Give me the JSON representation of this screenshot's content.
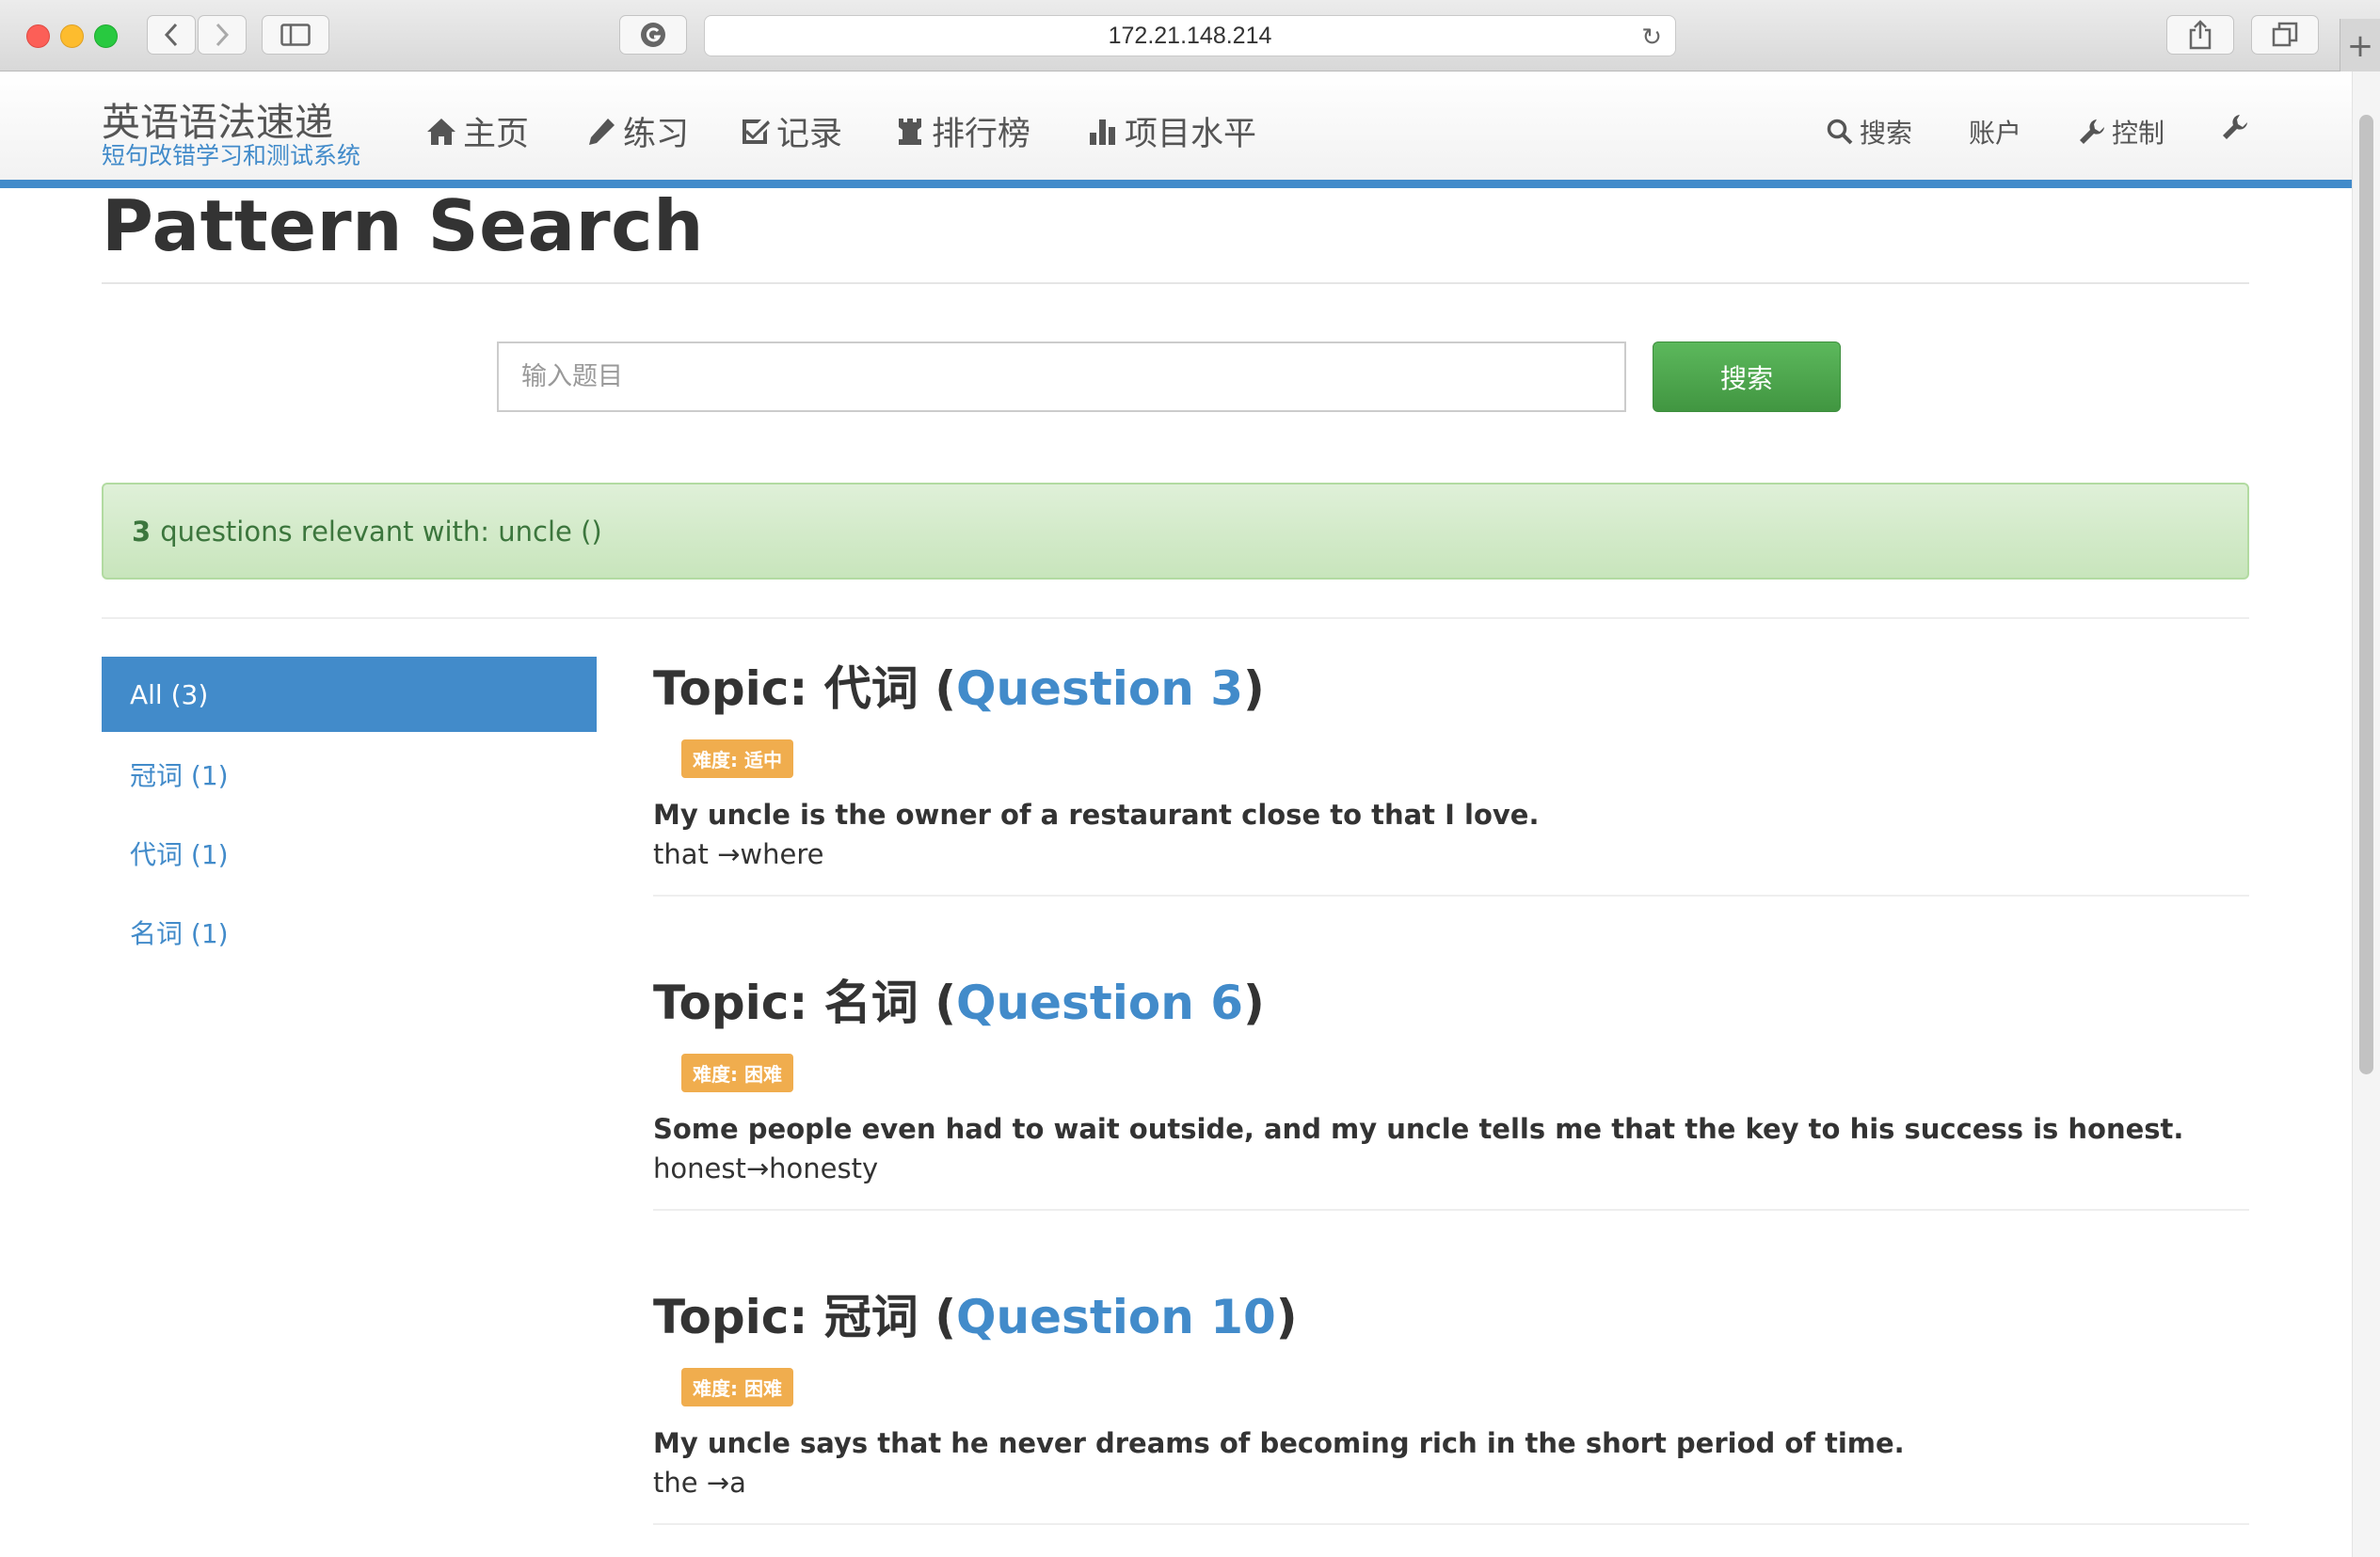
{
  "browser": {
    "url": "172.21.148.214"
  },
  "navbar": {
    "brand_title": "英语语法速递",
    "brand_subtitle": "短句改错学习和测试系统",
    "items": [
      {
        "label": "主页",
        "icon": "home-icon"
      },
      {
        "label": "练习",
        "icon": "pencil-icon"
      },
      {
        "label": "记录",
        "icon": "check-square-icon"
      },
      {
        "label": "排行榜",
        "icon": "tower-icon"
      },
      {
        "label": "项目水平",
        "icon": "bar-chart-icon"
      }
    ],
    "right_items": [
      {
        "label": "搜索",
        "icon": "search-icon"
      },
      {
        "label": "账户",
        "icon": ""
      },
      {
        "label": "控制",
        "icon": "wrench-icon"
      },
      {
        "label": "",
        "icon": "wrench-icon"
      }
    ]
  },
  "page": {
    "title": "Pattern Search"
  },
  "search": {
    "placeholder": "输入题目",
    "value": "",
    "button_label": "搜索"
  },
  "alert": {
    "count": "3",
    "text": "questions relevant with: uncle ()"
  },
  "sidebar": {
    "active": "All (3)",
    "items": [
      "冠词 (1)",
      "代词 (1)",
      "名词 (1)"
    ]
  },
  "results": [
    {
      "topic_prefix": "Topic: 代词 (",
      "question_link": "Question 3",
      "topic_suffix": ")",
      "difficulty": "难度: 适中",
      "sentence": "My uncle is the owner of a restaurant close to that I love.",
      "correction": "that →where"
    },
    {
      "topic_prefix": "Topic: 名词 (",
      "question_link": "Question 6",
      "topic_suffix": ")",
      "difficulty": "难度: 困难",
      "sentence": "Some people even had to wait outside, and my uncle tells me that the key to his success is honest.",
      "correction": "honest→honesty"
    },
    {
      "topic_prefix": "Topic: 冠词 (",
      "question_link": "Question 10",
      "topic_suffix": ")",
      "difficulty": "难度: 困难",
      "sentence": "My uncle says that he never dreams of becoming rich in the short period of time.",
      "correction": "the →a"
    }
  ],
  "colors": {
    "accent": "#428bca",
    "success": "#5cb85c",
    "warning": "#f0ad4e",
    "alert_bg": "#dff0d8",
    "alert_text": "#3c763d"
  }
}
